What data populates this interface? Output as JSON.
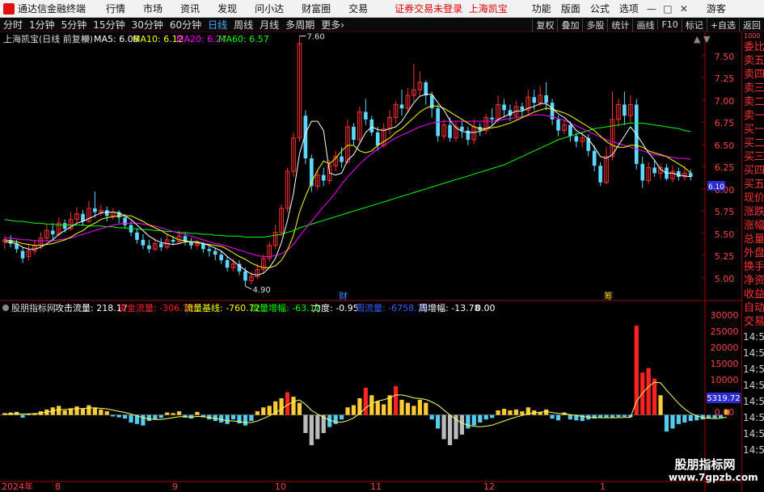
{
  "menubar": {
    "app_name": "通达信金融终端",
    "menus": [
      "行情",
      "市场",
      "资讯",
      "发现",
      "问小达",
      "财富圈",
      "交易"
    ],
    "notice": "证券交易未登录",
    "stock_name": "上海凯宝",
    "right_items": [
      "功能",
      "版面",
      "公式",
      "选项"
    ],
    "guest": "游客"
  },
  "periodbar": {
    "periods": [
      "分时",
      "1分钟",
      "5分钟",
      "15分钟",
      "30分钟",
      "60分钟",
      "日线",
      "周线",
      "月线",
      "多周期",
      "更多"
    ],
    "active": "日线",
    "tools": [
      "复权",
      "叠加",
      "多股",
      "统计",
      "画线",
      "F10",
      "标记",
      "+自选",
      "返回"
    ]
  },
  "main_chart": {
    "stock_label": "上海凯宝(日线 前复权)",
    "ma": [
      {
        "label": "MA5: 6.08",
        "color": "#ffffff"
      },
      {
        "label": "MA10: 6.12",
        "color": "#ffff00"
      },
      {
        "label": "MA20: 6.27",
        "color": "#ff00ff"
      },
      {
        "label": "MA60: 6.57",
        "color": "#00ff00"
      }
    ],
    "high_label": "7.60",
    "low_label": "4.90",
    "y_ticks": [
      "7.50",
      "7.25",
      "7.00",
      "6.75",
      "6.50",
      "6.25",
      "6.00",
      "5.75",
      "5.50",
      "5.25",
      "5.00"
    ],
    "markers": [
      "财",
      "筹"
    ],
    "price_tag": "6.10"
  },
  "sub_chart": {
    "indicator_name": "股朋指标网",
    "fields": [
      {
        "label": "攻击流量: 218.17",
        "color": "#ffffff"
      },
      {
        "label": "资金流量: -306.78",
        "color": "#ff2222"
      },
      {
        "label": "流量基线: -760.72",
        "color": "#ffff00"
      },
      {
        "label": "流量增幅: -63.12",
        "color": "#00ff00"
      },
      {
        "label": "力度: -0.95",
        "color": "#ffffff"
      },
      {
        "label": "周流量: -6758.78",
        "color": "#3060ff"
      },
      {
        "label": "周增幅: -13.78",
        "color": "#ffffff"
      },
      {
        "label": "0.00",
        "color": "#ffffff"
      }
    ],
    "y_ticks": [
      "30000",
      "25000",
      "20000",
      "15000",
      "10000",
      "5000",
      "0.00"
    ],
    "current_value": "5319.72"
  },
  "date_axis": [
    "2024年",
    "8",
    "9",
    "10",
    "11",
    "12",
    "1"
  ],
  "sidebar": {
    "labels": [
      "委比",
      "卖五",
      "卖四",
      "卖三",
      "卖二",
      "卖一",
      "买一",
      "买二",
      "买三",
      "买四",
      "买五",
      "现价",
      "涨跌",
      "涨幅",
      "总量",
      "外盘",
      "换手",
      "净资",
      "收益"
    ],
    "lower_labels": [
      "自动",
      "交易"
    ],
    "times": [
      "14:56",
      "14:56",
      "14:56",
      "14:56",
      "14:56",
      "14:56",
      "14:56",
      "14:56"
    ],
    "corner": "1000"
  },
  "watermark": {
    "line1": "股朋指标网",
    "line2": "www.7gpzb.com"
  },
  "colors": {
    "up": "#ff3030",
    "down": "#5fd8ff",
    "ma5": "#ffffff",
    "ma10": "#ffff00",
    "ma20": "#ff00ff",
    "ma60": "#00ff00",
    "axis": "#aa0000"
  },
  "chart_data": {
    "type": "candlestick",
    "title": "上海凯宝(日线 前复权)",
    "y_range": [
      4.85,
      7.7
    ],
    "candles": [
      [
        5.38,
        5.4,
        5.3,
        5.44
      ],
      [
        5.4,
        5.36,
        5.32,
        5.45
      ],
      [
        5.36,
        5.3,
        5.26,
        5.4
      ],
      [
        5.28,
        5.2,
        5.15,
        5.32
      ],
      [
        5.22,
        5.28,
        5.18,
        5.36
      ],
      [
        5.28,
        5.34,
        5.24,
        5.4
      ],
      [
        5.34,
        5.42,
        5.3,
        5.48
      ],
      [
        5.42,
        5.5,
        5.38,
        5.56
      ],
      [
        5.5,
        5.46,
        5.4,
        5.58
      ],
      [
        5.46,
        5.58,
        5.44,
        5.64
      ],
      [
        5.58,
        5.52,
        5.48,
        5.62
      ],
      [
        5.52,
        5.62,
        5.5,
        5.7
      ],
      [
        5.62,
        5.68,
        5.58,
        5.75
      ],
      [
        5.68,
        5.6,
        5.55,
        5.72
      ],
      [
        5.6,
        5.74,
        5.58,
        5.82
      ],
      [
        5.74,
        5.7,
        5.64,
        5.92
      ],
      [
        5.7,
        5.72,
        5.66,
        5.78
      ],
      [
        5.72,
        5.66,
        5.6,
        5.76
      ],
      [
        5.66,
        5.7,
        5.62,
        5.74
      ],
      [
        5.7,
        5.64,
        5.58,
        5.72
      ],
      [
        5.64,
        5.56,
        5.52,
        5.68
      ],
      [
        5.56,
        5.48,
        5.44,
        5.6
      ],
      [
        5.48,
        5.4,
        5.36,
        5.52
      ],
      [
        5.4,
        5.34,
        5.3,
        5.46
      ],
      [
        5.34,
        5.3,
        5.26,
        5.4
      ],
      [
        5.3,
        5.36,
        5.28,
        5.42
      ],
      [
        5.36,
        5.32,
        5.28,
        5.42
      ],
      [
        5.32,
        5.4,
        5.3,
        5.46
      ],
      [
        5.4,
        5.38,
        5.34,
        5.44
      ],
      [
        5.38,
        5.44,
        5.36,
        5.5
      ],
      [
        5.44,
        5.38,
        5.34,
        5.48
      ],
      [
        5.38,
        5.34,
        5.3,
        5.42
      ],
      [
        5.34,
        5.36,
        5.3,
        5.4
      ],
      [
        5.36,
        5.3,
        5.26,
        5.38
      ],
      [
        5.3,
        5.28,
        5.22,
        5.34
      ],
      [
        5.28,
        5.24,
        5.18,
        5.32
      ],
      [
        5.24,
        5.18,
        5.14,
        5.28
      ],
      [
        5.18,
        5.1,
        5.06,
        5.22
      ],
      [
        5.1,
        5.14,
        5.06,
        5.2
      ],
      [
        5.14,
        5.06,
        5.02,
        5.18
      ],
      [
        5.06,
        4.96,
        4.9,
        5.1
      ],
      [
        4.96,
        5.0,
        4.92,
        5.06
      ],
      [
        5.0,
        5.08,
        4.98,
        5.14
      ],
      [
        5.08,
        5.2,
        5.04,
        5.24
      ],
      [
        5.2,
        5.34,
        5.16,
        5.38
      ],
      [
        5.34,
        5.48,
        5.3,
        5.56
      ],
      [
        5.48,
        5.74,
        5.44,
        5.78
      ],
      [
        5.74,
        6.14,
        5.7,
        6.18
      ],
      [
        6.14,
        6.5,
        6.08,
        6.56
      ],
      [
        6.5,
        7.52,
        6.46,
        7.6
      ],
      [
        6.74,
        6.28,
        6.22,
        6.8
      ],
      [
        6.28,
        5.98,
        5.92,
        6.32
      ],
      [
        5.98,
        6.1,
        5.94,
        6.16
      ],
      [
        6.1,
        6.04,
        5.98,
        6.18
      ],
      [
        6.04,
        6.2,
        6.0,
        6.26
      ],
      [
        6.2,
        6.3,
        6.14,
        6.36
      ],
      [
        6.3,
        6.24,
        6.18,
        6.4
      ],
      [
        6.24,
        6.62,
        6.22,
        6.7
      ],
      [
        6.62,
        6.48,
        6.42,
        6.66
      ],
      [
        6.48,
        6.78,
        6.44,
        6.84
      ],
      [
        6.78,
        6.7,
        6.64,
        6.92
      ],
      [
        6.7,
        6.56,
        6.52,
        6.74
      ],
      [
        6.56,
        6.42,
        6.36,
        6.62
      ],
      [
        6.42,
        6.6,
        6.4,
        6.66
      ],
      [
        6.6,
        6.72,
        6.54,
        6.8
      ],
      [
        6.72,
        6.86,
        6.66,
        6.9
      ],
      [
        6.86,
        6.82,
        6.74,
        7.02
      ],
      [
        6.82,
        6.96,
        6.78,
        7.04
      ],
      [
        6.96,
        7.02,
        6.9,
        7.3
      ],
      [
        7.02,
        7.1,
        6.96,
        7.22
      ],
      [
        7.1,
        6.96,
        6.86,
        7.12
      ],
      [
        6.96,
        6.82,
        6.72,
        7.0
      ],
      [
        6.82,
        6.52,
        6.46,
        6.86
      ],
      [
        6.52,
        6.64,
        6.48,
        6.7
      ],
      [
        6.64,
        6.5,
        6.46,
        6.72
      ],
      [
        6.5,
        6.62,
        6.46,
        6.68
      ],
      [
        6.62,
        6.58,
        6.5,
        6.68
      ],
      [
        6.58,
        6.48,
        6.42,
        6.62
      ],
      [
        6.48,
        6.62,
        6.44,
        6.7
      ],
      [
        6.62,
        6.58,
        6.52,
        6.66
      ],
      [
        6.58,
        6.72,
        6.54,
        6.76
      ],
      [
        6.72,
        6.7,
        6.64,
        6.82
      ],
      [
        6.7,
        6.86,
        6.66,
        6.96
      ],
      [
        6.86,
        6.8,
        6.72,
        6.92
      ],
      [
        6.8,
        6.74,
        6.68,
        6.86
      ],
      [
        6.74,
        6.84,
        6.7,
        6.9
      ],
      [
        6.84,
        6.8,
        6.72,
        6.88
      ],
      [
        6.8,
        6.94,
        6.76,
        7.02
      ],
      [
        6.94,
        6.88,
        6.8,
        7.02
      ],
      [
        6.88,
        6.96,
        6.84,
        7.06
      ],
      [
        6.96,
        6.88,
        6.8,
        7.1
      ],
      [
        6.88,
        6.7,
        6.64,
        6.92
      ],
      [
        6.7,
        6.58,
        6.52,
        6.74
      ],
      [
        6.58,
        6.64,
        6.54,
        6.7
      ],
      [
        6.64,
        6.52,
        6.46,
        6.68
      ],
      [
        6.52,
        6.46,
        6.4,
        6.56
      ],
      [
        6.46,
        6.5,
        6.4,
        6.56
      ],
      [
        6.5,
        6.36,
        6.3,
        6.54
      ],
      [
        6.36,
        6.2,
        6.14,
        6.42
      ],
      [
        6.2,
        6.02,
        5.98,
        6.24
      ],
      [
        6.02,
        6.3,
        6.0,
        6.4
      ],
      [
        6.3,
        6.7,
        6.26,
        7.0
      ],
      [
        6.7,
        6.86,
        6.62,
        6.92
      ],
      [
        6.86,
        6.74,
        6.64,
        7.0
      ],
      [
        6.74,
        6.86,
        6.66,
        6.96
      ],
      [
        6.86,
        6.22,
        6.16,
        6.92
      ],
      [
        6.22,
        6.04,
        5.96,
        6.3
      ],
      [
        6.04,
        6.18,
        6.0,
        6.24
      ],
      [
        6.18,
        6.12,
        6.08,
        6.26
      ],
      [
        6.12,
        6.18,
        6.06,
        6.22
      ],
      [
        6.18,
        6.06,
        6.04,
        6.22
      ],
      [
        6.06,
        6.14,
        6.02,
        6.2
      ],
      [
        6.14,
        6.08,
        6.04,
        6.18
      ],
      [
        6.08,
        6.12,
        6.04,
        6.2
      ],
      [
        6.12,
        6.08,
        6.04,
        6.16
      ]
    ],
    "ma5": [
      5.38,
      5.37,
      5.36,
      5.32,
      5.3,
      5.3,
      5.32,
      5.36,
      5.4,
      5.46,
      5.5,
      5.54,
      5.58,
      5.6,
      5.63,
      5.66,
      5.69,
      5.7,
      5.7,
      5.69,
      5.66,
      5.62,
      5.56,
      5.5,
      5.44,
      5.4,
      5.37,
      5.36,
      5.35,
      5.36,
      5.38,
      5.38,
      5.38,
      5.36,
      5.34,
      5.31,
      5.28,
      5.22,
      5.17,
      5.12,
      5.07,
      5.03,
      5.02,
      5.04,
      5.1,
      5.2,
      5.37,
      5.61,
      5.9,
      6.33,
      6.55,
      6.68,
      6.68,
      6.58,
      6.12,
      6.1,
      6.12,
      6.26,
      6.32,
      6.44,
      6.56,
      6.62,
      6.59,
      6.58,
      6.6,
      6.62,
      6.68,
      6.78,
      6.88,
      6.95,
      6.97,
      6.97,
      6.88,
      6.8,
      6.69,
      6.61,
      6.57,
      6.56,
      6.56,
      6.57,
      6.6,
      6.63,
      6.7,
      6.73,
      6.76,
      6.79,
      6.79,
      6.82,
      6.84,
      6.87,
      6.87,
      6.82,
      6.76,
      6.72,
      6.66,
      6.58,
      6.54,
      6.49,
      6.4,
      6.3,
      6.28,
      6.32,
      6.42,
      6.52,
      6.62,
      6.54,
      6.44,
      6.34,
      6.26,
      6.16,
      6.12,
      6.12,
      6.1,
      6.09,
      6.08
    ],
    "ma10": [
      5.4,
      5.39,
      5.38,
      5.36,
      5.35,
      5.34,
      5.34,
      5.35,
      5.36,
      5.38,
      5.4,
      5.43,
      5.47,
      5.5,
      5.55,
      5.58,
      5.62,
      5.64,
      5.65,
      5.66,
      5.66,
      5.66,
      5.63,
      5.6,
      5.56,
      5.53,
      5.5,
      5.46,
      5.43,
      5.4,
      5.39,
      5.38,
      5.37,
      5.36,
      5.35,
      5.34,
      5.33,
      5.3,
      5.26,
      5.22,
      5.19,
      5.15,
      5.12,
      5.1,
      5.1,
      5.12,
      5.18,
      5.29,
      5.45,
      5.7,
      5.87,
      6.02,
      6.15,
      6.25,
      6.22,
      6.28,
      6.36,
      6.42,
      6.42,
      6.36,
      6.34,
      6.36,
      6.42,
      6.46,
      6.5,
      6.56,
      6.6,
      6.66,
      6.72,
      6.78,
      6.82,
      6.85,
      6.84,
      6.82,
      6.78,
      6.74,
      6.7,
      6.66,
      6.62,
      6.6,
      6.6,
      6.61,
      6.62,
      6.64,
      6.66,
      6.69,
      6.72,
      6.75,
      6.78,
      6.8,
      6.82,
      6.81,
      6.79,
      6.77,
      6.74,
      6.7,
      6.66,
      6.62,
      6.58,
      6.52,
      6.46,
      6.42,
      6.4,
      6.4,
      6.42,
      6.42,
      6.4,
      6.36,
      6.34,
      6.32,
      6.3,
      6.26,
      6.22,
      6.18,
      6.12
    ],
    "ma20": [
      5.42,
      5.42,
      5.41,
      5.4,
      5.4,
      5.39,
      5.39,
      5.39,
      5.39,
      5.4,
      5.41,
      5.42,
      5.44,
      5.46,
      5.48,
      5.5,
      5.52,
      5.54,
      5.56,
      5.57,
      5.58,
      5.58,
      5.58,
      5.57,
      5.56,
      5.55,
      5.53,
      5.51,
      5.49,
      5.47,
      5.46,
      5.44,
      5.42,
      5.4,
      5.38,
      5.36,
      5.35,
      5.33,
      5.31,
      5.29,
      5.27,
      5.25,
      5.23,
      5.22,
      5.22,
      5.23,
      5.25,
      5.29,
      5.35,
      5.44,
      5.52,
      5.6,
      5.68,
      5.76,
      5.83,
      5.91,
      6.0,
      6.08,
      6.15,
      6.22,
      6.28,
      6.33,
      6.38,
      6.42,
      6.46,
      6.5,
      6.53,
      6.56,
      6.59,
      6.62,
      6.64,
      6.66,
      6.67,
      6.68,
      6.68,
      6.68,
      6.68,
      6.68,
      6.68,
      6.68,
      6.68,
      6.68,
      6.69,
      6.7,
      6.71,
      6.72,
      6.73,
      6.74,
      6.75,
      6.75,
      6.74,
      6.73,
      6.71,
      6.69,
      6.66,
      6.63,
      6.6,
      6.57,
      6.54,
      6.51,
      6.48,
      6.46,
      6.44,
      6.42,
      6.4,
      6.38,
      6.36,
      6.34,
      6.32,
      6.31,
      6.3,
      6.29,
      6.28,
      6.28,
      6.27
    ],
    "ma60": [
      5.62,
      5.61,
      5.6,
      5.6,
      5.59,
      5.58,
      5.58,
      5.57,
      5.57,
      5.56,
      5.56,
      5.56,
      5.56,
      5.56,
      5.55,
      5.55,
      5.55,
      5.54,
      5.54,
      5.53,
      5.53,
      5.52,
      5.52,
      5.51,
      5.51,
      5.5,
      5.5,
      5.49,
      5.49,
      5.48,
      5.48,
      5.47,
      5.47,
      5.46,
      5.46,
      5.45,
      5.45,
      5.44,
      5.44,
      5.44,
      5.43,
      5.43,
      5.43,
      5.43,
      5.44,
      5.45,
      5.46,
      5.48,
      5.5,
      5.53,
      5.55,
      5.57,
      5.59,
      5.61,
      5.63,
      5.65,
      5.67,
      5.69,
      5.71,
      5.73,
      5.75,
      5.77,
      5.79,
      5.81,
      5.83,
      5.85,
      5.87,
      5.89,
      5.91,
      5.93,
      5.95,
      5.97,
      5.99,
      6.01,
      6.03,
      6.05,
      6.07,
      6.09,
      6.11,
      6.13,
      6.15,
      6.17,
      6.19,
      6.21,
      6.24,
      6.27,
      6.3,
      6.33,
      6.36,
      6.39,
      6.42,
      6.45,
      6.48,
      6.5,
      6.52,
      6.54,
      6.56,
      6.58,
      6.6,
      6.61,
      6.62,
      6.63,
      6.64,
      6.65,
      6.66,
      6.66,
      6.66,
      6.65,
      6.64,
      6.63,
      6.62,
      6.61,
      6.6,
      6.58,
      6.57
    ],
    "flow_range": [
      -22000,
      33000
    ],
    "flow": [
      600,
      800,
      1000,
      -900,
      400,
      600,
      1200,
      1800,
      2500,
      3000,
      1500,
      2200,
      2800,
      2000,
      3200,
      2500,
      1800,
      1200,
      -500,
      -800,
      -1200,
      -2500,
      -3000,
      -3500,
      -2000,
      -1500,
      -1000,
      800,
      600,
      1200,
      -900,
      -1200,
      1000,
      -800,
      -1500,
      -2000,
      -2500,
      -3000,
      -1500,
      -2800,
      -3500,
      -2000,
      1200,
      2500,
      3000,
      4500,
      5500,
      7500,
      6000,
      4000,
      -6000,
      -10000,
      -8000,
      -6000,
      -4000,
      -3000,
      -1500,
      2500,
      3200,
      5500,
      9000,
      6500,
      4500,
      3500,
      6500,
      9500,
      5000,
      4000,
      3000,
      5000,
      4000,
      -1500,
      -4500,
      -8000,
      -10000,
      -8000,
      -6500,
      -4500,
      -3500,
      -2500,
      -1500,
      -1000,
      1500,
      2000,
      1500,
      1800,
      1200,
      2500,
      1500,
      1000,
      1800,
      -1200,
      -1800,
      800,
      -1500,
      -1800,
      -2000,
      -1500,
      -1200,
      -1000,
      -800,
      -900,
      -700,
      -600,
      -800,
      29500,
      14000,
      15500,
      12000,
      6500,
      -5500,
      -4500,
      -3000,
      -2500,
      -2000,
      -1800,
      -1500,
      -1200,
      -1000,
      -900,
      1800
    ],
    "flow_line": [
      200,
      300,
      400,
      300,
      350,
      400,
      600,
      900,
      1300,
      1700,
      1800,
      1900,
      2100,
      2100,
      2300,
      2300,
      2200,
      2000,
      1600,
      1200,
      800,
      300,
      -300,
      -900,
      -1300,
      -1500,
      -1500,
      -1200,
      -900,
      -600,
      -600,
      -700,
      -500,
      -600,
      -800,
      -1100,
      -1500,
      -1900,
      -2000,
      -2200,
      -2500,
      -2500,
      -2000,
      -1200,
      -300,
      800,
      1900,
      3300,
      4400,
      4900,
      3500,
      1500,
      300,
      -800,
      -1700,
      -2300,
      -2400,
      -1900,
      -1000,
      500,
      2300,
      3700,
      4600,
      5000,
      5700,
      6600,
      6600,
      6200,
      5600,
      5400,
      5100,
      4300,
      3200,
      1600,
      0,
      -1500,
      -2700,
      -3400,
      -3800,
      -3900,
      -3700,
      -3400,
      -2700,
      -2000,
      -1300,
      -700,
      -200,
      400,
      700,
      900,
      1100,
      800,
      500,
      400,
      100,
      -200,
      -500,
      -700,
      -800,
      -900,
      -900,
      -900,
      -900,
      -800,
      -800,
      4500,
      7200,
      9400,
      10800,
      10600,
      8200,
      6000,
      3800,
      2000,
      600,
      -300,
      -900,
      -1100,
      -1200,
      -1100,
      -700
    ]
  }
}
